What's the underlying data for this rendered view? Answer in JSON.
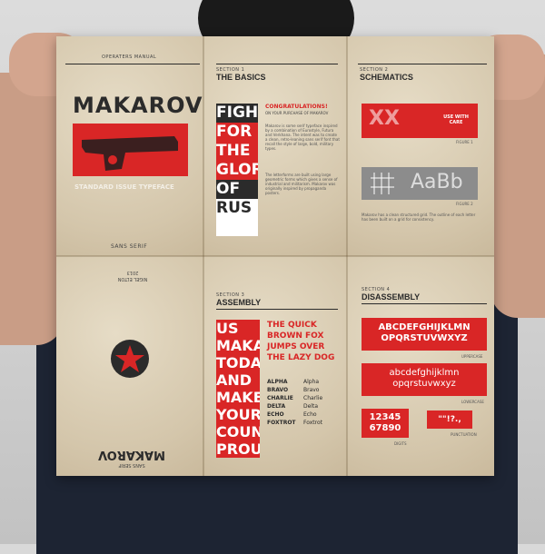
{
  "scene": {
    "colors": {
      "red": "#d92626",
      "paper": "#d8ccb4",
      "ink": "#2b2b2b",
      "shirt": "#1d2433"
    }
  },
  "panel_cover": {
    "header": "OPERATERS MANUAL",
    "title": "MAKAROV",
    "subtitle": "STANDARD ISSUE TYPEFACE",
    "footer": "SANS SERIF",
    "image_icon": "pistol-icon"
  },
  "panel_basics": {
    "section": "SECTION 1",
    "title": "THE BASICS",
    "heading": "CONGRATULATIONS!",
    "subheading": "ON YOUR PURCHASE OF MAKAROV",
    "sample_words": [
      "FIGH",
      "FOR",
      "THE",
      "GLORY",
      "OF",
      "RUS"
    ],
    "body_1": "Makarov is some serif typeface inspired by a combination of Eurostyle, Futura and Verkhana. The intent was to create a clean, retro-leaning sans serif font that recall the style of large, bold, military types.",
    "body_2": "The letterforms are built using large geometric forms which gives a sense of industrial and militarism. Makarov was originally inspired by propaganda posters."
  },
  "panel_technical": {
    "section": "SECTION 2",
    "title": "SCHEMATICS",
    "use_with_care": "USE WITH CARE",
    "figure_1": "FIGURE 1",
    "figure_2": "FIGURE 2",
    "grey_text": "AaBb",
    "body": "Makarov has a clean structured grid. The outline of each letter has been built on a grid for consistency."
  },
  "panel_back": {
    "author": "NIGEL ELTON",
    "year": "2013",
    "title": "MAKAROV",
    "subtitle": "SANS SERIF",
    "star_icon": "star-icon"
  },
  "panel_assembly": {
    "section": "SECTION 3",
    "title": "ASSEMBLY",
    "sample_words": [
      "US",
      "MAKAR",
      "TODA",
      "AND",
      "MAKE",
      "YOUR",
      "COUNT",
      "PROU"
    ],
    "pangram": "THE QUICK BROWN FOX JUMPS OVER THE LAZY DOG",
    "list_bold": [
      "ALPHA",
      "BRAVO",
      "CHARLIE",
      "DELTA",
      "ECHO",
      "FOXTROT"
    ],
    "list_regular": [
      "Alpha",
      "Bravo",
      "Charlie",
      "Delta",
      "Echo",
      "Foxtrot"
    ]
  },
  "panel_disassembly": {
    "section": "SECTION 4",
    "title": "DISASSEMBLY",
    "upper_1": "ABCDEFGHIJKLMN",
    "upper_2": "OPQRSTUVWXYZ",
    "upper_label": "UPPERCASE",
    "lower_1": "abcdefghijklmn",
    "lower_2": "opqrstuvwxyz",
    "lower_label": "LOWERCASE",
    "digits_1": "12345",
    "digits_2": "67890",
    "digits_label": "DIGITS",
    "punct": "\"\"!?.,",
    "punct_label": "PUNCTUATION"
  }
}
